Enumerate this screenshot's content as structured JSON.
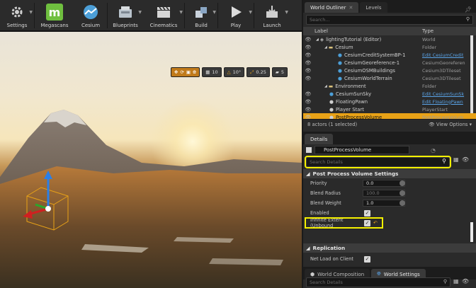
{
  "toolbar": {
    "buttons": [
      {
        "label": "Settings",
        "icon": "gear-icon"
      },
      {
        "label": "Megascans",
        "icon": "megascans-icon"
      },
      {
        "label": "Cesium",
        "icon": "cesium-icon"
      },
      {
        "label": "Blueprints",
        "icon": "blueprints-icon"
      },
      {
        "label": "Cinematics",
        "icon": "clapper-icon"
      },
      {
        "label": "Build",
        "icon": "build-icon"
      },
      {
        "label": "Play",
        "icon": "play-icon"
      },
      {
        "label": "Launch",
        "icon": "launch-icon"
      }
    ]
  },
  "viewport": {
    "grid_snap": "10",
    "angle_snap": "10°",
    "scale_snap": "0.25",
    "camera_speed": "5"
  },
  "outliner": {
    "tabs": [
      "World Outliner",
      "Levels"
    ],
    "search_placeholder": "Search...",
    "col_label": "Label",
    "col_type": "Type",
    "rows": [
      {
        "label": "lightingTutorial (Editor)",
        "type": "World",
        "link": false,
        "indent": 0
      },
      {
        "label": "Cesium",
        "type": "Folder",
        "link": false,
        "indent": 1
      },
      {
        "label": "CesiumCreditSystemBP-1",
        "type": "Edit CesiumCredit",
        "link": true,
        "indent": 2
      },
      {
        "label": "CesiumGeoreference-1",
        "type": "CesiumGeoreferen",
        "link": false,
        "indent": 2
      },
      {
        "label": "CesiumOSMBuildings",
        "type": "Cesium3DTileset",
        "link": false,
        "indent": 2
      },
      {
        "label": "CesiumWorldTerrain",
        "type": "Cesium3DTileset",
        "link": false,
        "indent": 2
      },
      {
        "label": "Environment",
        "type": "Folder",
        "link": false,
        "indent": 1
      },
      {
        "label": "CesiumSunSky",
        "type": "Edit CesiumSunSk",
        "link": true,
        "indent": 1
      },
      {
        "label": "FloatingPawn",
        "type": "Edit FloatingPawn",
        "link": true,
        "indent": 1
      },
      {
        "label": "Player Start",
        "type": "PlayerStart",
        "link": false,
        "indent": 1
      },
      {
        "label": "PostProcessVolume",
        "type": "PostProcessVolum",
        "link": false,
        "indent": 1,
        "selected": true
      }
    ],
    "footer_count": "8 actors (1 selected)",
    "view_options": "View Options"
  },
  "details": {
    "tab": "Details",
    "object_name": "PostProcessVolume",
    "search_placeholder": "Search Details",
    "category": "Post Process Volume Settings",
    "props": {
      "priority_label": "Priority",
      "priority_value": "0.0",
      "blend_radius_label": "Blend Radius",
      "blend_radius_value": "100.0",
      "blend_weight_label": "Blend Weight",
      "blend_weight_value": "1.0",
      "enabled_label": "Enabled",
      "infinite_label": "Infinite Extent (Unbound"
    },
    "replication_category": "Replication",
    "net_load_label": "Net Load on Client"
  },
  "bottom": {
    "tabs": [
      "World Composition",
      "World Settings"
    ],
    "search_placeholder": "Search Details"
  },
  "colors": {
    "selection": "#e8a217",
    "highlight": "#f5f100",
    "link": "#5aa4e8"
  }
}
